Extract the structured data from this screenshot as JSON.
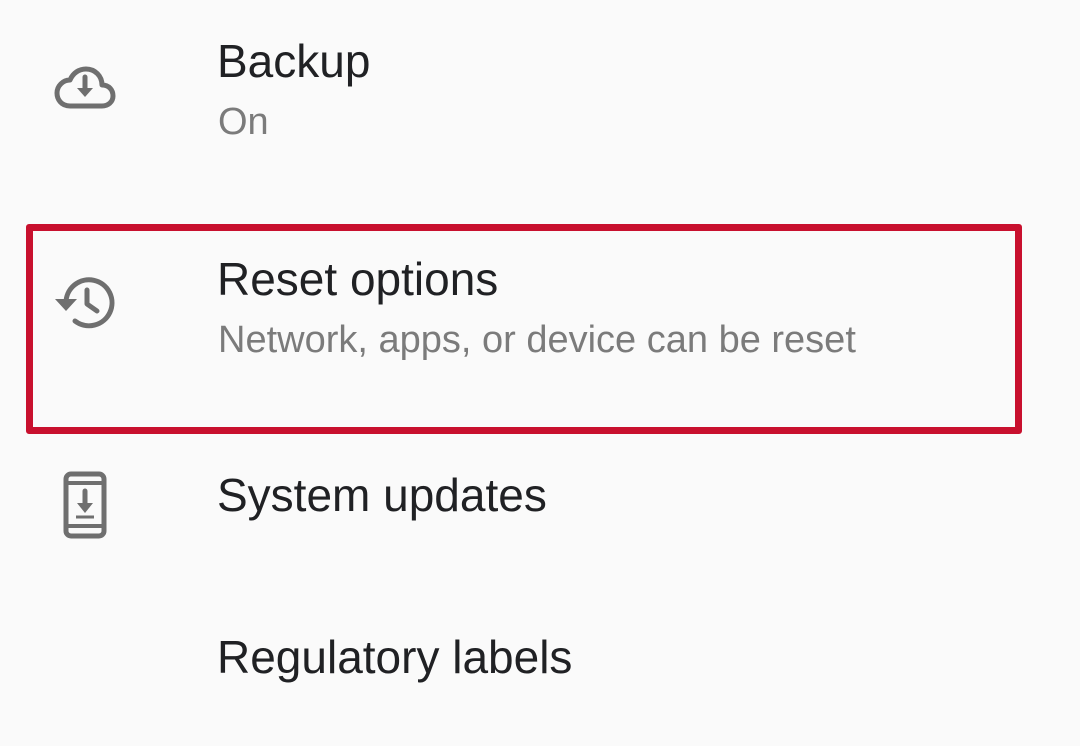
{
  "settings_list": {
    "items": [
      {
        "title": "Backup",
        "subtitle": "On",
        "icon": "cloud-download-icon"
      },
      {
        "title": "Reset options",
        "subtitle": "Network, apps, or device can be reset",
        "icon": "history-icon"
      },
      {
        "title": "System updates",
        "icon": "system-update-icon"
      },
      {
        "title": "Regulatory labels"
      }
    ]
  },
  "colors": {
    "background": "#fafafa",
    "title_text": "#202124",
    "subtitle_text": "#7b7b7b",
    "icon": "#6f6f6f",
    "highlight_border": "#c8102e"
  }
}
